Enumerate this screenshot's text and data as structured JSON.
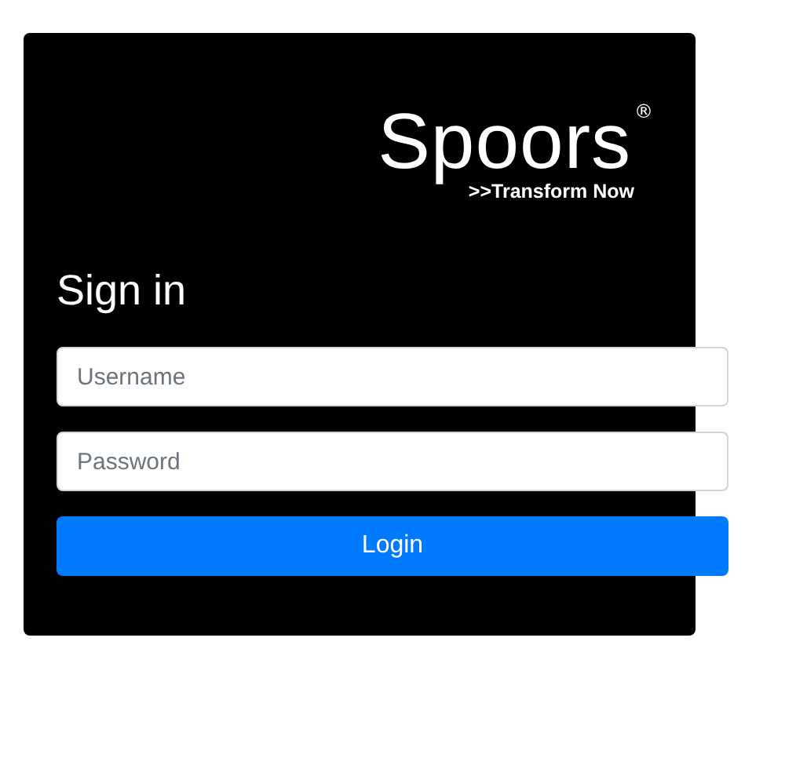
{
  "logo": {
    "name": "Spoors",
    "mark": "®",
    "tagline": ">>Transform Now"
  },
  "heading": "Sign in",
  "fields": [
    {
      "placeholder": "Username"
    },
    {
      "placeholder": "Password"
    }
  ],
  "button": "Login"
}
